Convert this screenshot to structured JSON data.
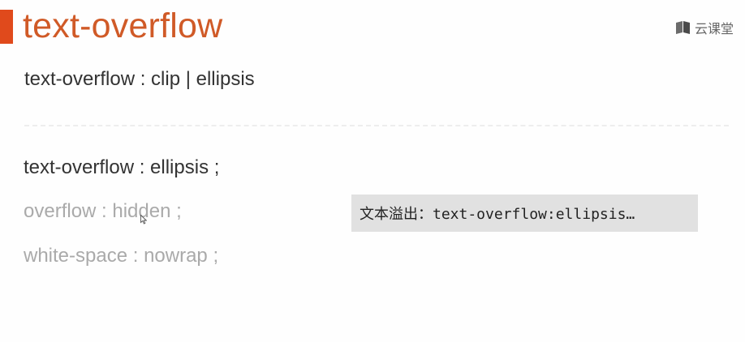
{
  "slide": {
    "title": "text-overflow",
    "brand": {
      "name": "云课堂",
      "icon": "book-icon"
    },
    "syntax": "text-overflow : clip | ellipsis",
    "rules": [
      "text-overflow : ellipsis ;",
      "overflow : hidden ;",
      "white-space : nowrap ;"
    ],
    "demo_text": "文本溢出：text-overflow:ellipsis…",
    "colors": {
      "accent": "#e04a1c",
      "title": "#d05a27",
      "demo_background": "#e1e1e1",
      "muted_text": "#aaaaaa"
    }
  }
}
